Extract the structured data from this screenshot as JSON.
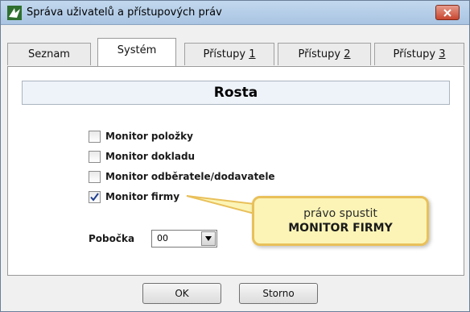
{
  "window": {
    "title": "Správa uživatelů a přístupových práv",
    "close_icon": "close-icon",
    "app_icon": "app-logo-icon"
  },
  "tabs": [
    {
      "label": "Seznam",
      "active": false
    },
    {
      "label": "Systém",
      "active": true
    },
    {
      "label": "Přístupy ",
      "accel": "1",
      "active": false
    },
    {
      "label": "Přístupy ",
      "accel": "2",
      "active": false
    },
    {
      "label": "Přístupy ",
      "accel": "3",
      "active": false
    }
  ],
  "user": {
    "name": "Rosta"
  },
  "permissions": [
    {
      "label": "Monitor položky",
      "checked": false
    },
    {
      "label": "Monitor dokladu",
      "checked": false
    },
    {
      "label": "Monitor odběratele/dodavatele",
      "checked": false
    },
    {
      "label": "Monitor firmy",
      "checked": true
    }
  ],
  "branch": {
    "label": "Pobočka",
    "value": "00"
  },
  "callout": {
    "line1": "právo spustit",
    "line2": "MONITOR FIRMY"
  },
  "buttons": {
    "ok": "OK",
    "cancel": "Storno"
  },
  "colors": {
    "callout_fill": "#fbf4b6",
    "callout_border": "#e9c05a",
    "titlebar": "#b5cde8",
    "close": "#c8462f"
  }
}
